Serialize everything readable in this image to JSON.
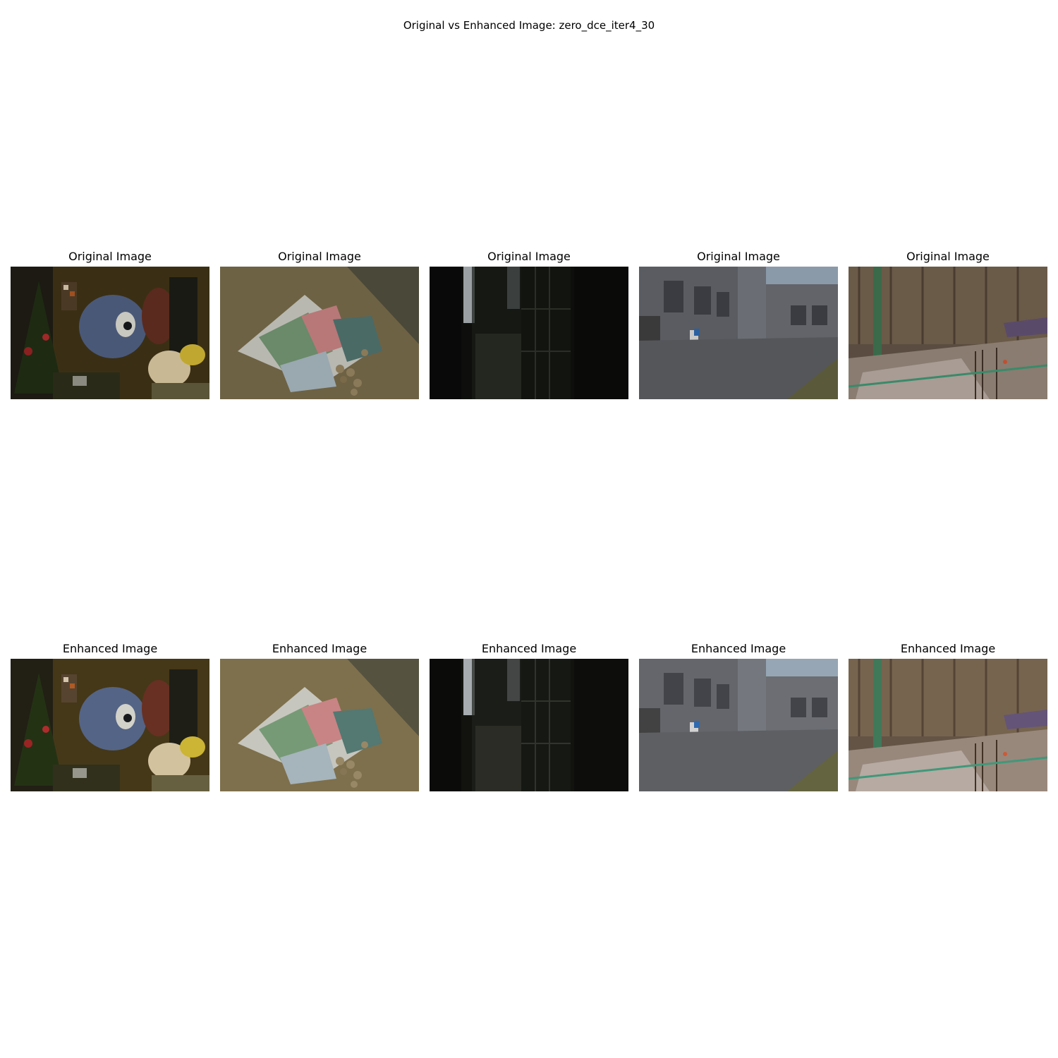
{
  "figure": {
    "title": "Original vs Enhanced Image: zero_dce_iter4_30"
  },
  "rows": [
    {
      "panels": [
        {
          "title": "Original Image",
          "scene": "toys-room"
        },
        {
          "title": "Original Image",
          "scene": "banknotes-coins"
        },
        {
          "title": "Original Image",
          "scene": "dark-doorway"
        },
        {
          "title": "Original Image",
          "scene": "building-courtyard"
        },
        {
          "title": "Original Image",
          "scene": "construction-site"
        }
      ]
    },
    {
      "panels": [
        {
          "title": "Enhanced Image",
          "scene": "toys-room"
        },
        {
          "title": "Enhanced Image",
          "scene": "banknotes-coins"
        },
        {
          "title": "Enhanced Image",
          "scene": "dark-doorway"
        },
        {
          "title": "Enhanced Image",
          "scene": "building-courtyard"
        },
        {
          "title": "Enhanced Image",
          "scene": "construction-site"
        }
      ]
    }
  ]
}
